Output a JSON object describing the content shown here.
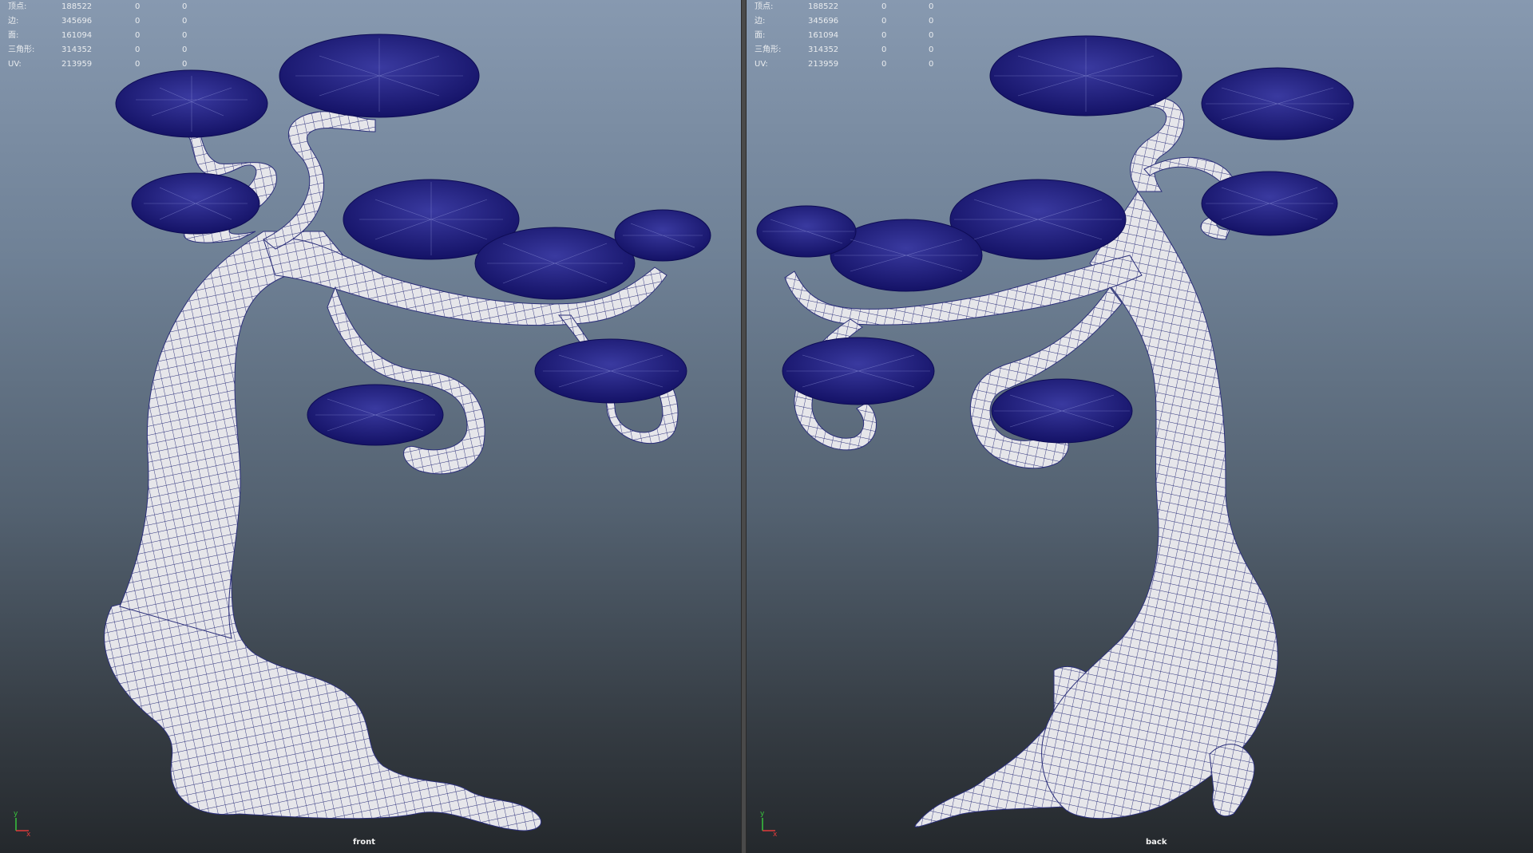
{
  "stats": [
    {
      "label": "顶点:",
      "value": "188522",
      "z1": "0",
      "z2": "0"
    },
    {
      "label": "边:",
      "value": "345696",
      "z1": "0",
      "z2": "0"
    },
    {
      "label": "面:",
      "value": "161094",
      "z1": "0",
      "z2": "0"
    },
    {
      "label": "三角形:",
      "value": "314352",
      "z1": "0",
      "z2": "0"
    },
    {
      "label": "UV:",
      "value": "213959",
      "z1": "0",
      "z2": "0"
    }
  ],
  "viewports": {
    "left": {
      "camera": "front"
    },
    "right": {
      "camera": "back"
    }
  },
  "axis": {
    "y": "y",
    "x": "x",
    "y_color": "#39c43d",
    "x_color": "#e23b3b"
  },
  "colors": {
    "foliage": "#1c1a7a",
    "mesh": "#e6e6ea",
    "wire": "#2b2f7a"
  }
}
